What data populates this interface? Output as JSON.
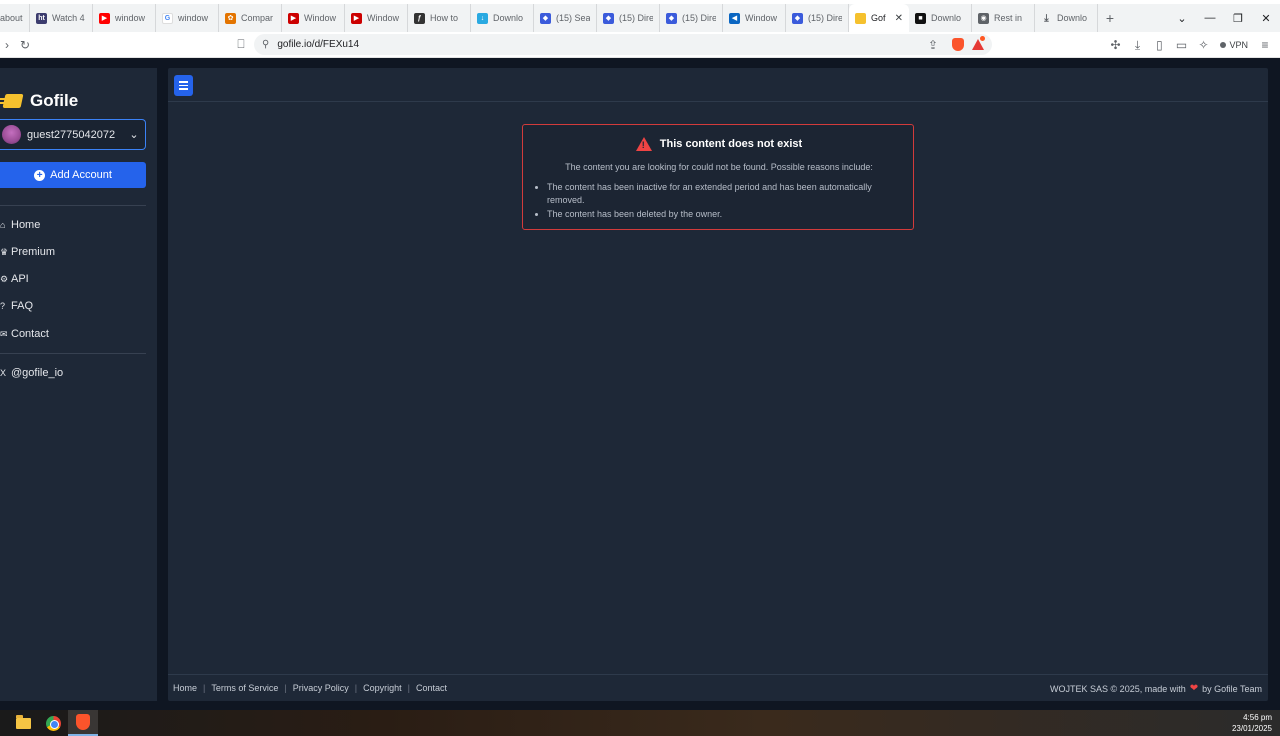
{
  "browser": {
    "tabs": [
      {
        "title": "about:w",
        "favicon_color": "#9aa0a6",
        "icon": "page-icon"
      },
      {
        "title": "Watch 4",
        "favicon_color": "#3c3c6e",
        "icon": "ht-icon"
      },
      {
        "title": "window",
        "favicon_color": "#ff0000",
        "icon": "youtube-icon"
      },
      {
        "title": "window",
        "favicon_color": "#4285f4",
        "icon": "google-icon"
      },
      {
        "title": "Compar",
        "favicon_color": "#e37400",
        "icon": "gear-icon"
      },
      {
        "title": "Window",
        "favicon_color": "#cc0000",
        "icon": "youtube-icon"
      },
      {
        "title": "Window",
        "favicon_color": "#cc0000",
        "icon": "youtube-icon"
      },
      {
        "title": "How to",
        "favicon_color": "#333333",
        "icon": "curl-icon"
      },
      {
        "title": "Downlo",
        "favicon_color": "#29a9e1",
        "icon": "download-icon"
      },
      {
        "title": "(15) Sea",
        "favicon_color": "#3b5bdb",
        "icon": "shield-icon"
      },
      {
        "title": "(15) Dire",
        "favicon_color": "#3b5bdb",
        "icon": "shield-icon"
      },
      {
        "title": "(15) Dire",
        "favicon_color": "#3b5bdb",
        "icon": "shield-icon"
      },
      {
        "title": "Window",
        "favicon_color": "#0a66c2",
        "icon": "bird-icon"
      },
      {
        "title": "(15) Dire",
        "favicon_color": "#3b5bdb",
        "icon": "shield-icon"
      },
      {
        "title": "Gof",
        "favicon_color": "#f5c12e",
        "icon": "gofile-icon",
        "active": true
      },
      {
        "title": "Downlo",
        "favicon_color": "#111111",
        "icon": "app-icon"
      },
      {
        "title": "Rest in",
        "favicon_color": "#5f6368",
        "icon": "globe-icon"
      },
      {
        "title": "Downlo",
        "favicon_color": "#5f6368",
        "icon": "download-icon"
      }
    ],
    "tab_close": "✕",
    "new_tab": "+",
    "url": "gofile.io/d/FEXu14",
    "vpn_label": "VPN"
  },
  "sidebar": {
    "brand": "Gofile",
    "account_name": "guest2775042072",
    "add_account_label": "Add Account",
    "nav": [
      {
        "label": "Home",
        "icon": "home-icon",
        "glyph": "⌂"
      },
      {
        "label": "Premium",
        "icon": "crown-icon",
        "glyph": "♛"
      },
      {
        "label": "API",
        "icon": "gear-icon",
        "glyph": "⚙"
      },
      {
        "label": "FAQ",
        "icon": "question-icon",
        "glyph": "?"
      },
      {
        "label": "Contact",
        "icon": "mail-icon",
        "glyph": "✉"
      }
    ],
    "social": {
      "label": "@gofile_io",
      "icon": "x-icon",
      "glyph": "X"
    }
  },
  "alert": {
    "title": "This content does not exist",
    "description": "The content you are looking for could not be found. Possible reasons include:",
    "reasons": [
      "The content has been inactive for an extended period and has been automatically removed.",
      "The content has been deleted by the owner."
    ],
    "border_color": "#d23b3b"
  },
  "footer": {
    "links": [
      "Home",
      "Terms of Service",
      "Privacy Policy",
      "Copyright",
      "Contact"
    ],
    "copyright_prefix": "WOJTEK SAS © 2025, made with",
    "copyright_suffix": "by Gofile Team"
  },
  "taskbar": {
    "time": "4:56 pm",
    "date": "23/01/2025"
  },
  "colors": {
    "accent": "#2563eb",
    "panel": "#1e2837",
    "background": "#0f1622",
    "danger": "#ef4444"
  }
}
